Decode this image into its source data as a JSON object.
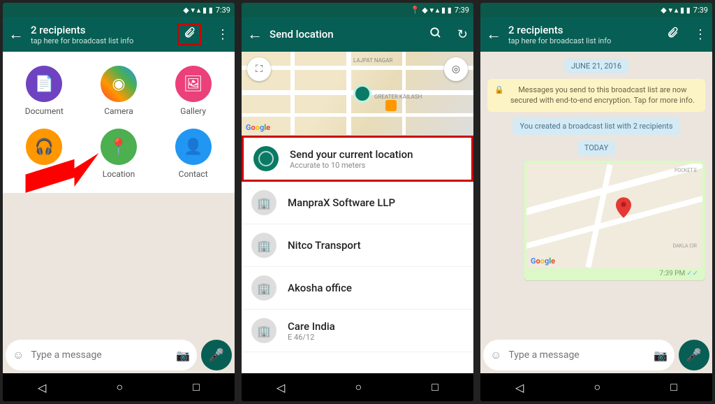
{
  "status": {
    "time": "7:39"
  },
  "screen1": {
    "header": {
      "title": "2 recipients",
      "subtitle": "tap here for broadcast list info"
    },
    "attachments": [
      {
        "label": "Document"
      },
      {
        "label": "Camera"
      },
      {
        "label": "Gallery"
      },
      {
        "label": "Audio"
      },
      {
        "label": "Location"
      },
      {
        "label": "Contact"
      }
    ],
    "input_placeholder": "Type a message"
  },
  "screen2": {
    "title": "Send location",
    "current": {
      "title": "Send your current location",
      "subtitle": "Accurate to 10 meters"
    },
    "places": [
      {
        "name": "ManpraX Software LLP",
        "sub": ""
      },
      {
        "name": "Nitco Transport",
        "sub": ""
      },
      {
        "name": "Akosha office",
        "sub": ""
      },
      {
        "name": "Care India",
        "sub": "E 46/12"
      }
    ],
    "map_labels": [
      "LAJPAT NAGAR",
      "GREATER KAILASH"
    ]
  },
  "screen3": {
    "header": {
      "title": "2 recipients",
      "subtitle": "tap here for broadcast list info"
    },
    "date1": "JUNE 21, 2016",
    "encryption_notice": "Messages you send to this broadcast list are now secured with end-to-end encryption. Tap for more info.",
    "system_msg": "You created a broadcast list with 2 recipients",
    "date2": "TODAY",
    "msg_time": "7:39 PM",
    "input_placeholder": "Type a message"
  }
}
